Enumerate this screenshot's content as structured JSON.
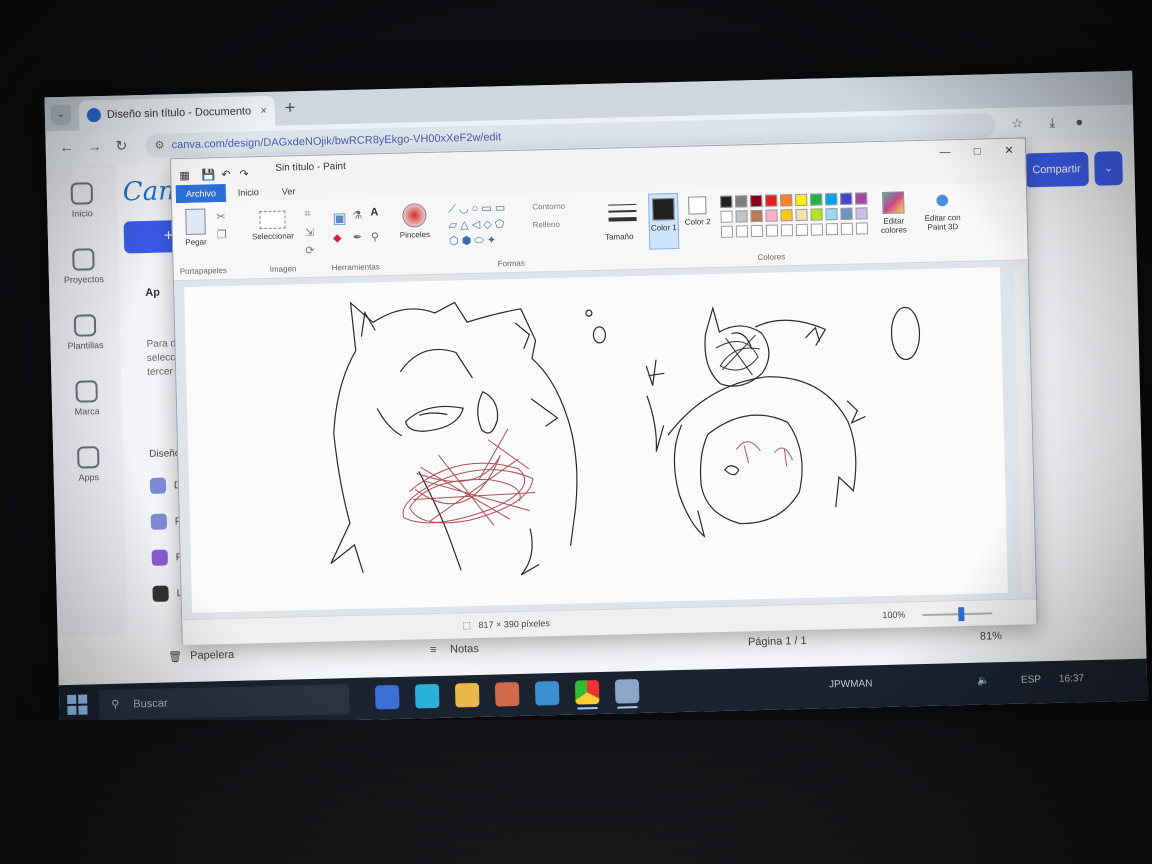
{
  "browser": {
    "tab_title": "Diseño sin título - Documento",
    "tab_close": "×",
    "new_tab": "+",
    "url": "canva.com/design/DAGxdeNOjik/bwRCR8yEkgo-VH00xXeF2w/edit",
    "nav": {
      "back": "←",
      "forward": "→",
      "reload": "↻"
    }
  },
  "canva": {
    "logo": "Canva",
    "create_button": "+",
    "share_button": "Compartir",
    "rail": [
      {
        "label": "Inicio",
        "icon": "home-icon"
      },
      {
        "label": "Proyectos",
        "icon": "folder-icon"
      },
      {
        "label": "Plantillas",
        "icon": "template-icon"
      },
      {
        "label": "Marca",
        "icon": "brand-icon"
      },
      {
        "label": "Apps",
        "icon": "apps-icon"
      }
    ],
    "side_heading": "Ap",
    "side_text": [
      "Para d",
      "seleccione",
      "tercer A"
    ],
    "recent_heading": "Diseños r",
    "recent_items": [
      "Di",
      "Pr",
      "Fo",
      "Lo"
    ],
    "footer": {
      "trash": "Papelera",
      "notes": "Notas",
      "page": "Página 1 / 1",
      "zoom": "81%"
    }
  },
  "paint": {
    "title": "Sin título - Paint",
    "window_controls": {
      "min": "—",
      "max": "□",
      "close": "✕"
    },
    "tabs": [
      "Archivo",
      "Inicio",
      "Ver"
    ],
    "ribbon": {
      "paste": "Pegar",
      "clipboard_group": "Portapapeles",
      "select": "Seleccionar",
      "image_group": "Imagen",
      "tools_group": "Herramientas",
      "brushes": "Pinceles",
      "outline": "Contorno",
      "fill": "Relleno",
      "shapes_group": "Formas",
      "size": "Tamaño",
      "color1": "Color 1",
      "color2": "Color 2",
      "edit_colors": "Editar colores",
      "paint3d": "Editar con Paint 3D",
      "colors_group": "Colores"
    },
    "palette": [
      "#202020",
      "#7f7f7f",
      "#880015",
      "#ed1c24",
      "#ff7f27",
      "#fff200",
      "#22b14c",
      "#00a2e8",
      "#3f48cc",
      "#a349a4",
      "#ffffff",
      "#c3c3c3",
      "#b97a57",
      "#ffaec9",
      "#ffc90e",
      "#efe4b0",
      "#b5e61d",
      "#99d9ea",
      "#7092be",
      "#c8bfe7"
    ],
    "status": {
      "size": "817 × 390 píxeles",
      "zoom": "100%"
    }
  },
  "taskbar": {
    "search_placeholder": "Buscar",
    "weather": "JPWMAN",
    "lang": "ESP",
    "time": "16:37"
  }
}
